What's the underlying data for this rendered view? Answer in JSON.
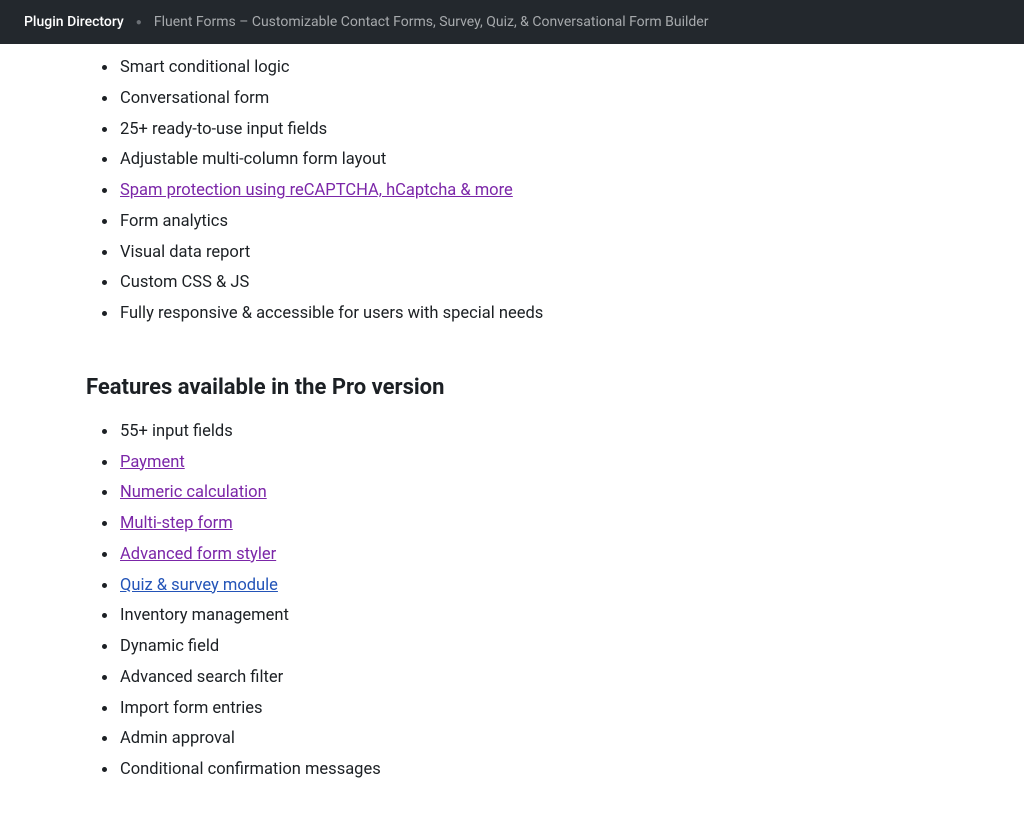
{
  "header": {
    "directory_link": "Plugin Directory",
    "page_title": "Fluent Forms – Customizable Contact Forms, Survey, Quiz, & Conversational Form Builder"
  },
  "free_features": {
    "items": [
      {
        "text": "Smart conditional logic",
        "link": false
      },
      {
        "text": "Conversational form",
        "link": false
      },
      {
        "text": "25+ ready-to-use input fields",
        "link": false
      },
      {
        "text": "Adjustable multi-column form layout",
        "link": false
      },
      {
        "text": "Spam protection using reCAPTCHA, hCaptcha & more",
        "link": true,
        "visited": true
      },
      {
        "text": "Form analytics",
        "link": false
      },
      {
        "text": "Visual data report",
        "link": false
      },
      {
        "text": "Custom CSS & JS",
        "link": false
      },
      {
        "text": "Fully responsive & accessible for users with special needs",
        "link": false
      }
    ]
  },
  "pro_section": {
    "heading": "Features available in the Pro version",
    "items": [
      {
        "text": "55+ input fields",
        "link": false
      },
      {
        "text": "Payment",
        "link": true,
        "visited": true
      },
      {
        "text": "Numeric calculation",
        "link": true,
        "visited": true
      },
      {
        "text": "Multi-step form",
        "link": true,
        "visited": true
      },
      {
        "text": "Advanced form styler",
        "link": true,
        "visited": true
      },
      {
        "text": "Quiz & survey module",
        "link": true,
        "visited": false
      },
      {
        "text": "Inventory management",
        "link": false
      },
      {
        "text": "Dynamic field",
        "link": false
      },
      {
        "text": "Advanced search filter",
        "link": false
      },
      {
        "text": "Import form entries",
        "link": false
      },
      {
        "text": "Admin approval",
        "link": false
      },
      {
        "text": "Conditional confirmation messages",
        "link": false
      }
    ]
  }
}
